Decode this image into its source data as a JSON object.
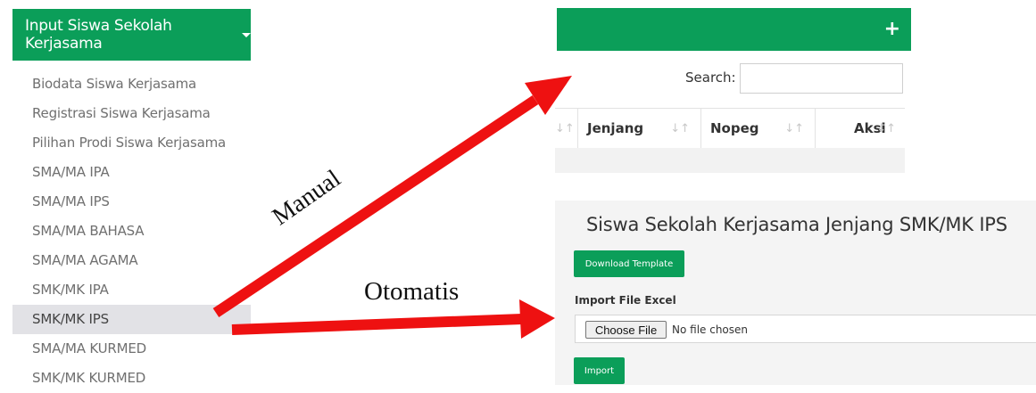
{
  "menu": {
    "header_label": "Input Siswa Sekolah Kerjasama",
    "items": [
      {
        "label": "Biodata Siswa Kerjasama"
      },
      {
        "label": "Registrasi Siswa Kerjasama"
      },
      {
        "label": "Pilihan Prodi Siswa Kerjasama"
      },
      {
        "label": "SMA/MA IPA"
      },
      {
        "label": "SMA/MA IPS"
      },
      {
        "label": "SMA/MA BAHASA"
      },
      {
        "label": "SMA/MA AGAMA"
      },
      {
        "label": "SMK/MK IPA"
      },
      {
        "label": "SMK/MK IPS",
        "active": true
      },
      {
        "label": "SMA/MA KURMED"
      },
      {
        "label": "SMK/MK KURMED"
      }
    ]
  },
  "manual_panel": {
    "add_icon": "plus-icon",
    "search_label": "Search:",
    "search_value": "",
    "columns": [
      "Jenjang",
      "Nopeg",
      "Aksi"
    ]
  },
  "import_panel": {
    "title": "Siswa Sekolah Kerjasama Jenjang SMK/MK IPS",
    "download_button": "Download Template",
    "file_label": "Import File Excel",
    "choose_file_button": "Choose File",
    "no_file_text": "No file chosen",
    "import_button": "Import"
  },
  "annotations": {
    "manual_label": "Manual",
    "otomatis_label": "Otomatis",
    "arrow_color": "#ee1111"
  },
  "colors": {
    "brand_green": "#0b9e59",
    "active_item_bg": "#e2e2e6"
  }
}
